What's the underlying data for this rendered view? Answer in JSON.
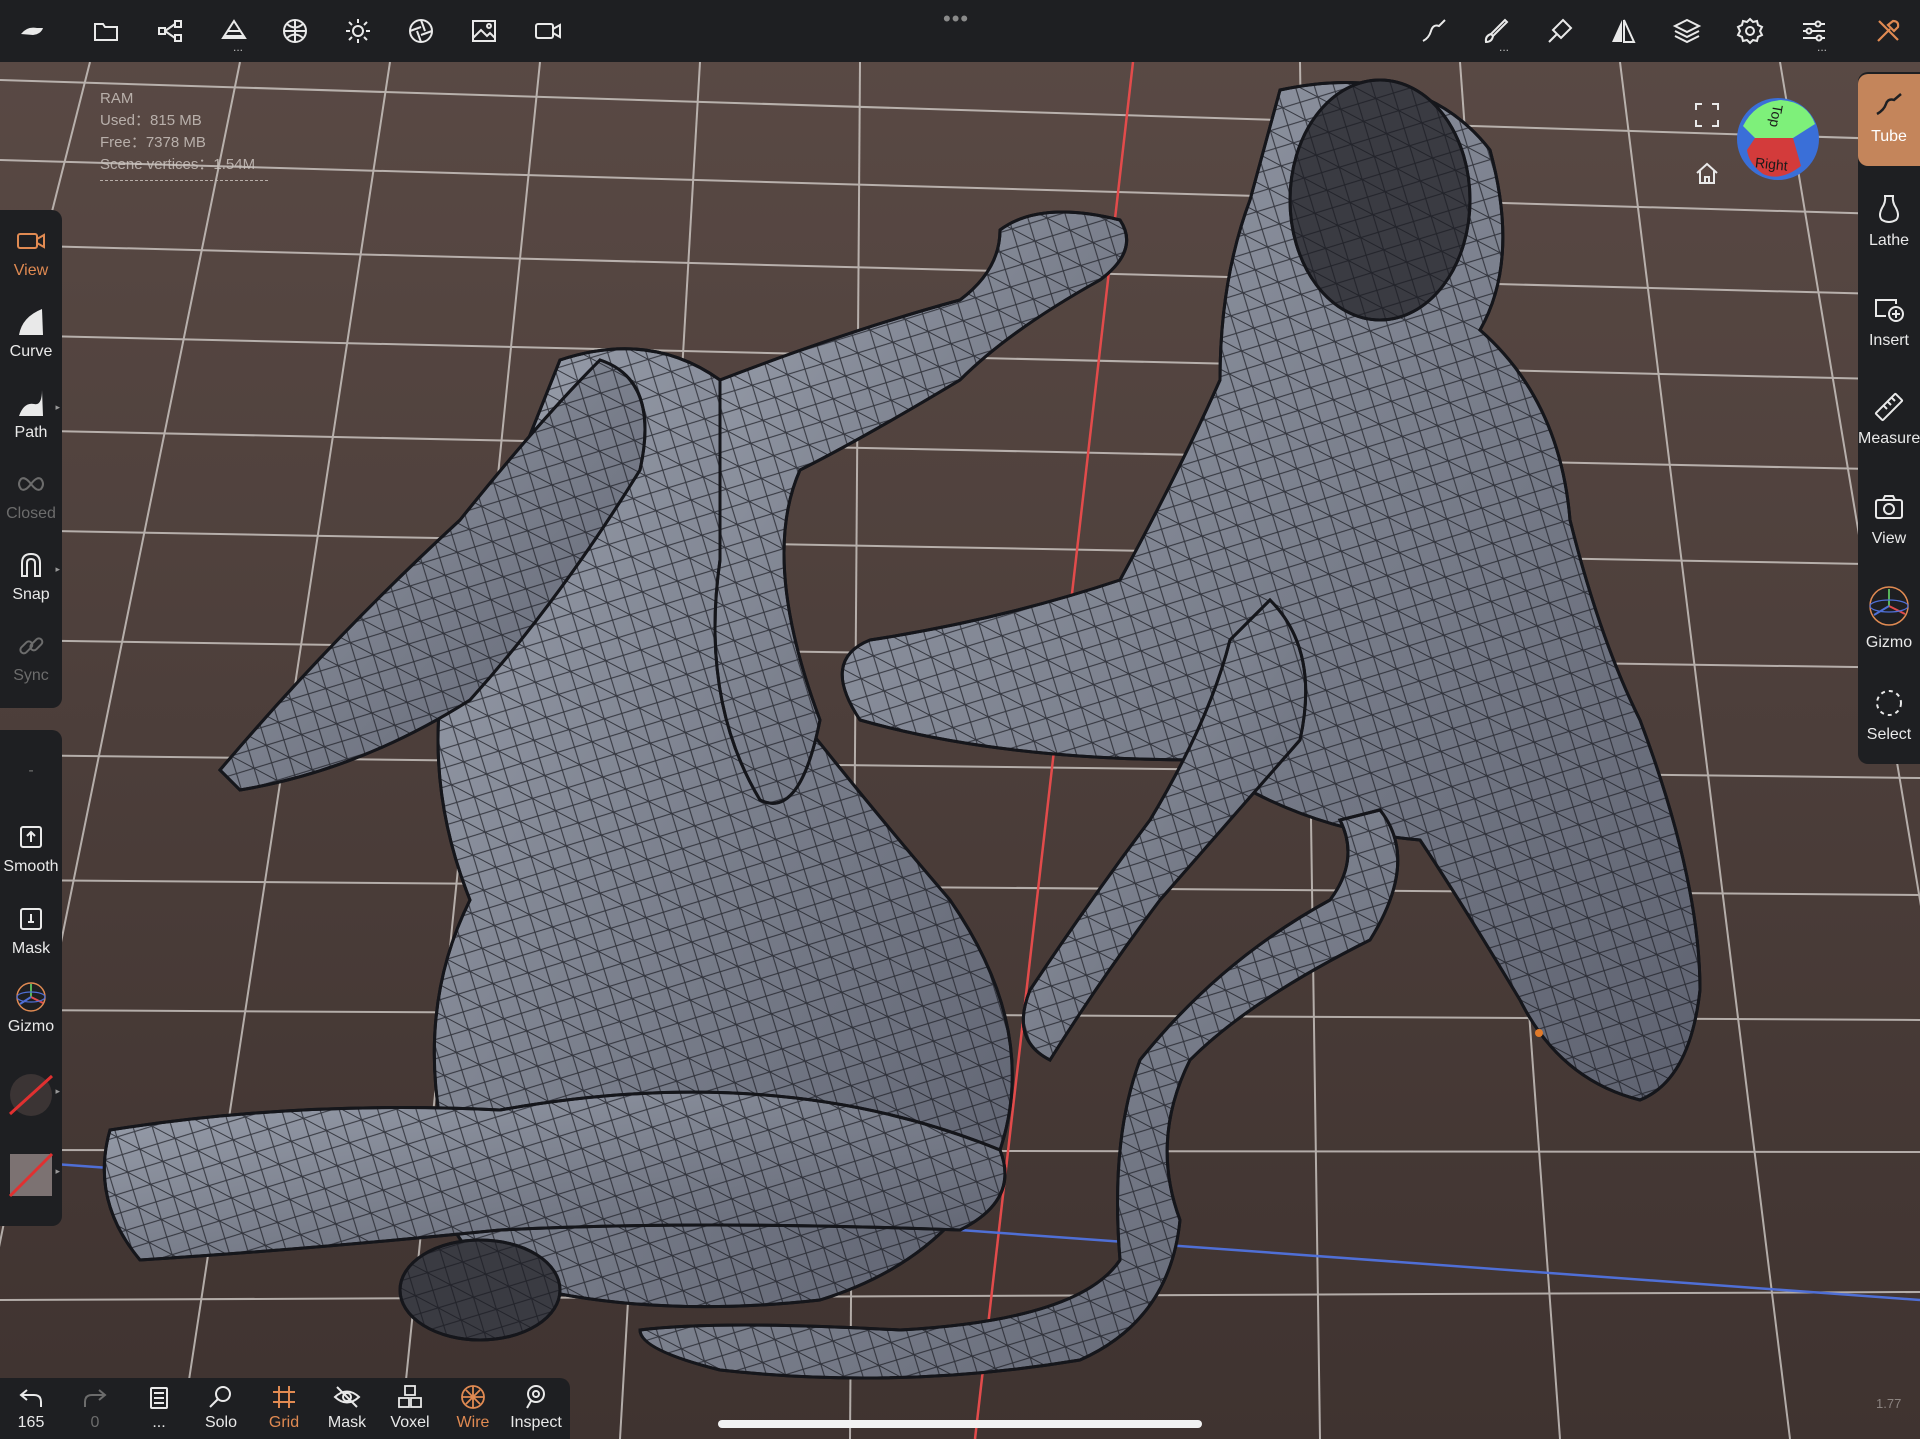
{
  "top_toolbar": {
    "left_icons": [
      "nomad-logo-icon",
      "folder-icon",
      "scene-graph-icon",
      "primitives-icon",
      "material-icon",
      "light-icon",
      "postprocess-icon",
      "background-image-icon",
      "camera-icon"
    ],
    "right_icons": [
      "stroke-icon",
      "brush-icon",
      "paint-tools-icon",
      "symmetry-icon",
      "layers-icon",
      "settings-icon",
      "sliders-icon",
      "tools-icon"
    ]
  },
  "ram": {
    "title": "RAM",
    "used": "Used：815 MB",
    "free": "Free：7378 MB",
    "vertices": "Scene vertices：1.54M"
  },
  "left_toolbar": {
    "view": "View",
    "curve": "Curve",
    "path": "Path",
    "closed": "Closed",
    "snap": "Snap",
    "sync": "Sync",
    "dash": "-",
    "smooth": "Smooth",
    "mask": "Mask",
    "gizmo": "Gizmo"
  },
  "right_toolbar": {
    "tube": "Tube",
    "lathe": "Lathe",
    "insert": "Insert",
    "measure": "Measure",
    "view": "View",
    "gizmo": "Gizmo",
    "select": "Select"
  },
  "view_cube": {
    "top": "Top",
    "right": "Right"
  },
  "bottom_toolbar": {
    "undo_count": "165",
    "redo_count": "0",
    "history_dots": "...",
    "solo": "Solo",
    "grid": "Grid",
    "mask": "Mask",
    "voxel": "Voxel",
    "wire": "Wire",
    "inspect": "Inspect"
  },
  "version": "1.77",
  "colors": {
    "accent": "#e08a52",
    "panel": "#1e1f22",
    "background": "#4a3d39",
    "grid": "#d9d4d0",
    "mesh": "#8a8f9c",
    "axis_red": "#e24b4b",
    "axis_blue": "#4f6fd6"
  }
}
